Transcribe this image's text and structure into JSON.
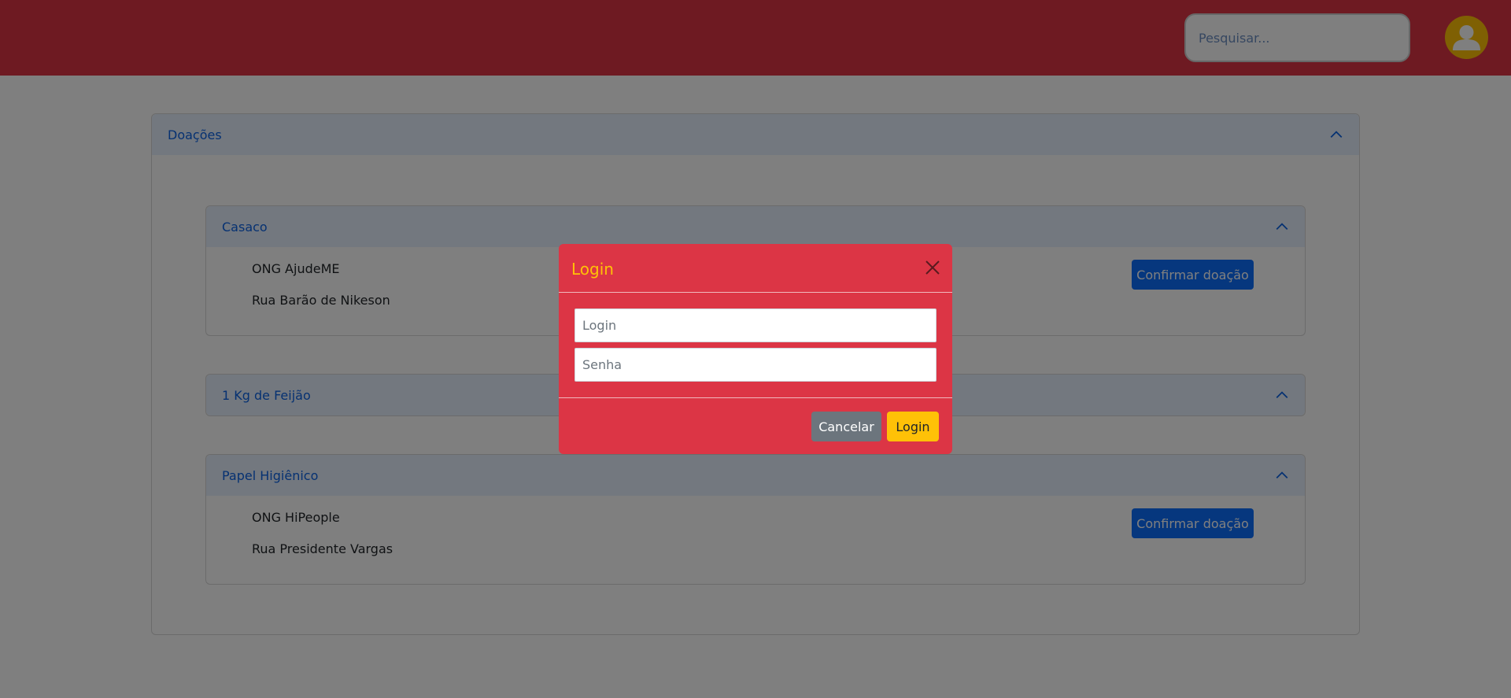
{
  "header": {
    "search_placeholder": "Pesquisar...",
    "avatar_icon": "user-icon"
  },
  "donations": {
    "title": "Doações",
    "items": [
      {
        "title": "Casaco",
        "org": "ONG AjudeME",
        "address": "Rua Barão de Nikeson",
        "button": "Confirmar doação"
      },
      {
        "title": "1 Kg de Feijão"
      },
      {
        "title": "Papel Higiênico",
        "org": "ONG HiPeople",
        "address": "Rua Presidente Vargas",
        "button": "Confirmar doação"
      }
    ]
  },
  "modal": {
    "title": "Login",
    "login_placeholder": "Login",
    "password_placeholder": "Senha",
    "cancel_label": "Cancelar",
    "login_label": "Login"
  },
  "colors": {
    "header_bg": "#dc3545",
    "modal_bg": "#dc3545",
    "modal_title": "#ffc107",
    "primary": "#0d6efd",
    "accordion_bg": "#e7f1ff",
    "avatar_bg": "#ffc107"
  }
}
